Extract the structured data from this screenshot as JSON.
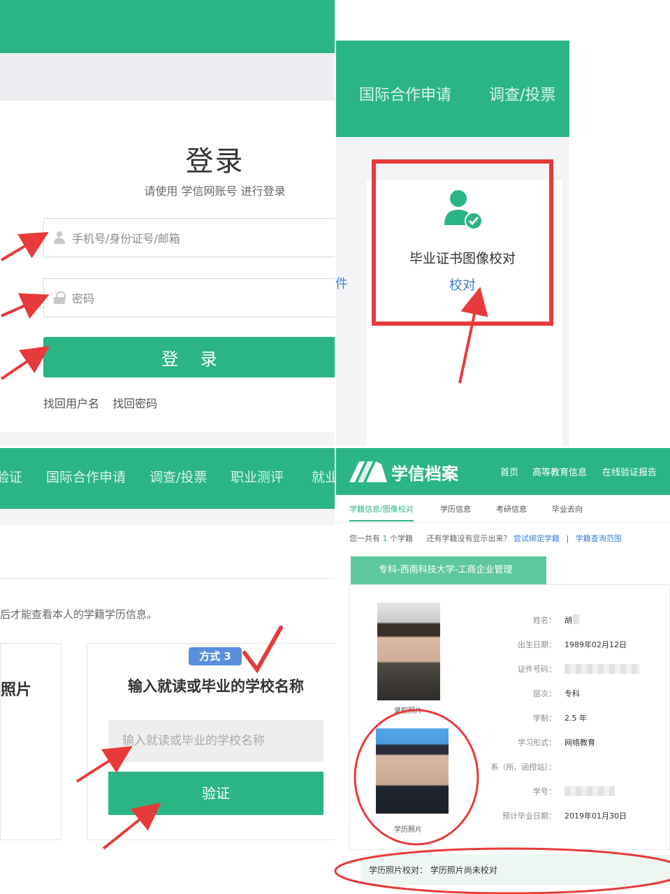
{
  "login": {
    "title": "登录",
    "subtitle": "请使用 学信网账号 进行登录",
    "account_placeholder": "手机号/身份证号/邮箱",
    "password_placeholder": "密码",
    "login_button": "登 录",
    "links": [
      "找回用户名",
      "找回密码"
    ]
  },
  "services": {
    "nav": [
      "国际合作申请",
      "调查/投票"
    ],
    "fragment_text": "件",
    "cert_title": "毕业证书图像校对",
    "cert_link": "校对"
  },
  "school_verify": {
    "nav": [
      "验证",
      "国际合作申请",
      "调查/投票",
      "职业测评",
      "就业"
    ],
    "hint": "后才能查看本人的学籍学历信息。",
    "left_card_fragment": "照片",
    "method_badge": "方式 3",
    "card_title": "输入就读或毕业的学校名称",
    "input_placeholder": "输入就读或毕业的学校名称",
    "verify_button": "验证"
  },
  "archive": {
    "brand": "学信档案",
    "top_nav": [
      "首页",
      "高等教育信息",
      "在线验证报告"
    ],
    "tabs": [
      "学籍信息/图像校对",
      "学历信息",
      "考研信息",
      "毕业去向"
    ],
    "count_prefix": "您一共有",
    "count": "1",
    "count_suffix": "个学籍",
    "missing_text": "还有学籍没有显示出来？",
    "bind_link": "尝试绑定学籍",
    "separator": "|",
    "scope_link": "学籍查询范围",
    "record_title": "专科-西南科技大学-工商企业管理",
    "photo1_caption": "录取照片",
    "photo2_caption": "学历照片",
    "fields": [
      {
        "label": "姓名：",
        "value": "胡"
      },
      {
        "label": "出生日期：",
        "value": "1989年02月12日"
      },
      {
        "label": "证件号码：",
        "value": ""
      },
      {
        "label": "层次：",
        "value": "专科"
      },
      {
        "label": "学制：",
        "value": "2.5 年"
      },
      {
        "label": "学习形式：",
        "value": "网络教育"
      },
      {
        "label": "系（所、函授站）：",
        "value": ""
      },
      {
        "label": "学号：",
        "value": ""
      },
      {
        "label": "预计毕业日期：",
        "value": "2019年01月30日"
      }
    ],
    "footer_label": "学历照片校对：",
    "footer_value": "学历照片尚未校对"
  },
  "colors": {
    "brand_green": "#2bb584",
    "annotation_red": "#e83a3a",
    "link_blue": "#3c7dd9"
  }
}
